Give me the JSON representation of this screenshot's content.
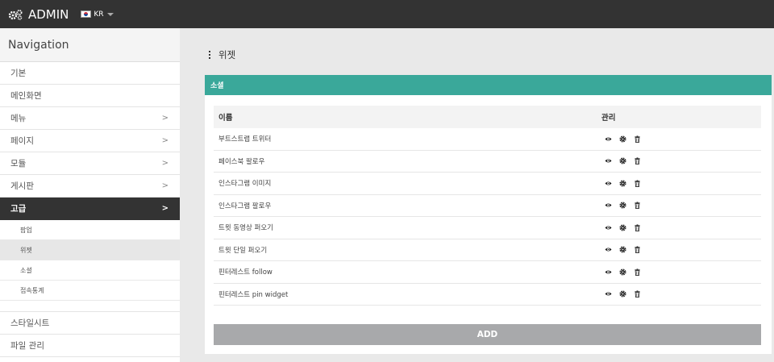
{
  "topbar": {
    "brand_label": "ADMIN",
    "lang_code": "KR"
  },
  "sidebar": {
    "heading": "Navigation",
    "items_top": [
      {
        "label": "기본",
        "has_chevron": false
      },
      {
        "label": "메인화면",
        "has_chevron": false
      },
      {
        "label": "메뉴",
        "has_chevron": true
      },
      {
        "label": "페이지",
        "has_chevron": true
      },
      {
        "label": "모듈",
        "has_chevron": true
      },
      {
        "label": "게시판",
        "has_chevron": true
      }
    ],
    "active_item": {
      "label": "고급",
      "chevron": ">"
    },
    "subitems": [
      "팝업",
      "위젯",
      "소셜",
      "접속통계"
    ],
    "current_subitem": "위젯",
    "items_bottom": [
      "스타일시트",
      "파일 관리"
    ],
    "chevron": ">"
  },
  "page": {
    "title": "위젯"
  },
  "panel": {
    "title": "소셜",
    "header_color": "#3aa89a",
    "columns": {
      "name": "이름",
      "manage": "관리"
    },
    "rows": [
      "부트스트랩 트위터",
      "페이스북 팔로우",
      "인스타그램 이미지",
      "인스타그램 팔로우",
      "트윗 동영상 퍼오기",
      "트윗 단일 퍼오기",
      "핀터레스트 follow",
      "핀터레스트 pin widget"
    ],
    "row_actions": [
      "eye-icon",
      "gear-icon",
      "trash-icon"
    ],
    "add_label": "ADD"
  }
}
